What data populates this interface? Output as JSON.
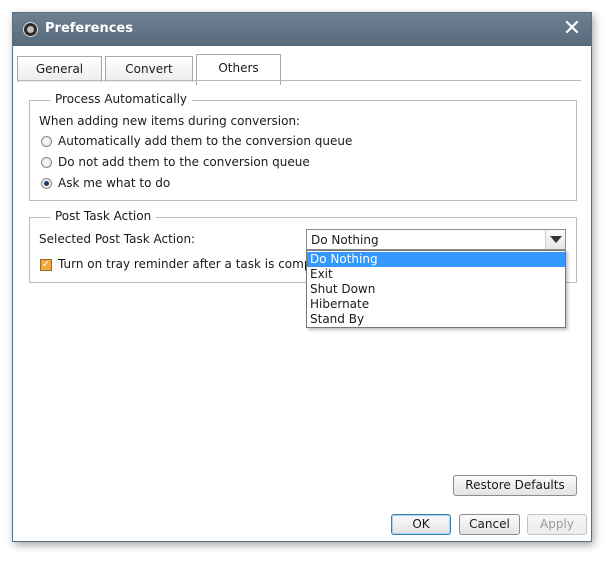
{
  "window": {
    "title": "Preferences",
    "close_glyph": "✕"
  },
  "tabs": [
    {
      "label": "General"
    },
    {
      "label": "Convert"
    },
    {
      "label": "Others",
      "active": true
    }
  ],
  "process_automatically": {
    "legend": "Process Automatically",
    "prompt": "When adding new items during conversion:",
    "options": [
      {
        "label": "Automatically add them to the conversion queue",
        "checked": false
      },
      {
        "label": "Do not add them to the conversion queue",
        "checked": false
      },
      {
        "label": "Ask me what to do",
        "checked": true
      }
    ]
  },
  "post_task_action": {
    "legend": "Post Task Action",
    "selected_label": "Selected Post Task Action:",
    "selected_value": "Do Nothing",
    "options": [
      "Do Nothing",
      "Exit",
      "Shut Down",
      "Hibernate",
      "Stand By"
    ],
    "tray_reminder": {
      "label": "Turn on tray reminder after a task is complete",
      "checked": true
    }
  },
  "buttons": {
    "restore_defaults": "Restore Defaults",
    "ok": "OK",
    "cancel": "Cancel",
    "apply": "Apply"
  },
  "colors": {
    "titlebar": "#5f7386",
    "selection": "#3399ff",
    "checkbox": "#f0a93a"
  },
  "icons": {
    "app": "app-logo-icon",
    "close": "close-icon",
    "dropdown": "chevron-down-icon",
    "check": "checkmark-icon"
  }
}
